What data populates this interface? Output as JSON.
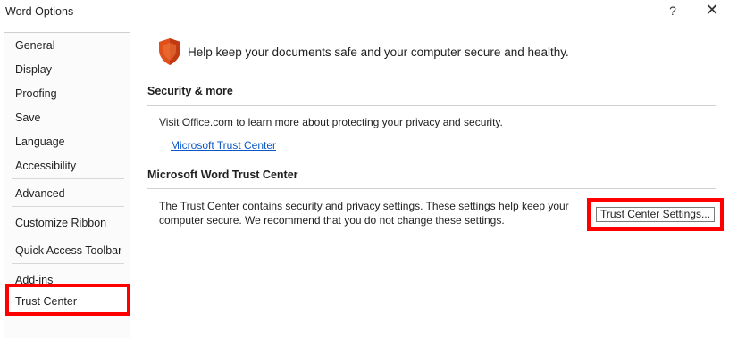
{
  "window": {
    "title": "Word Options",
    "help_label": "?",
    "close_label": "✕"
  },
  "sidebar": {
    "items": [
      {
        "label": "General"
      },
      {
        "label": "Display"
      },
      {
        "label": "Proofing"
      },
      {
        "label": "Save"
      },
      {
        "label": "Language"
      },
      {
        "label": "Accessibility"
      },
      {
        "label": "Advanced"
      },
      {
        "label": "Customize Ribbon"
      },
      {
        "label": "Quick Access Toolbar"
      },
      {
        "label": "Add-ins"
      },
      {
        "label": "Trust Center",
        "selected": true
      }
    ]
  },
  "main": {
    "intro": "Help keep your documents safe and your computer secure and healthy.",
    "security": {
      "heading": "Security & more",
      "text": "Visit Office.com to learn more about protecting your privacy and security.",
      "link": "Microsoft Trust Center"
    },
    "trust_center": {
      "heading": "Microsoft Word Trust Center",
      "line1": "The Trust Center contains security and privacy settings. These settings help keep your",
      "line2": "computer secure. We recommend that you do not change these settings.",
      "button_label": "Trust Center Settings..."
    }
  },
  "colors": {
    "highlight": "#ff0000",
    "link": "#0b57c8",
    "shield": "#e0501b"
  },
  "icons": [
    "help-icon",
    "close-icon",
    "shield-icon"
  ]
}
